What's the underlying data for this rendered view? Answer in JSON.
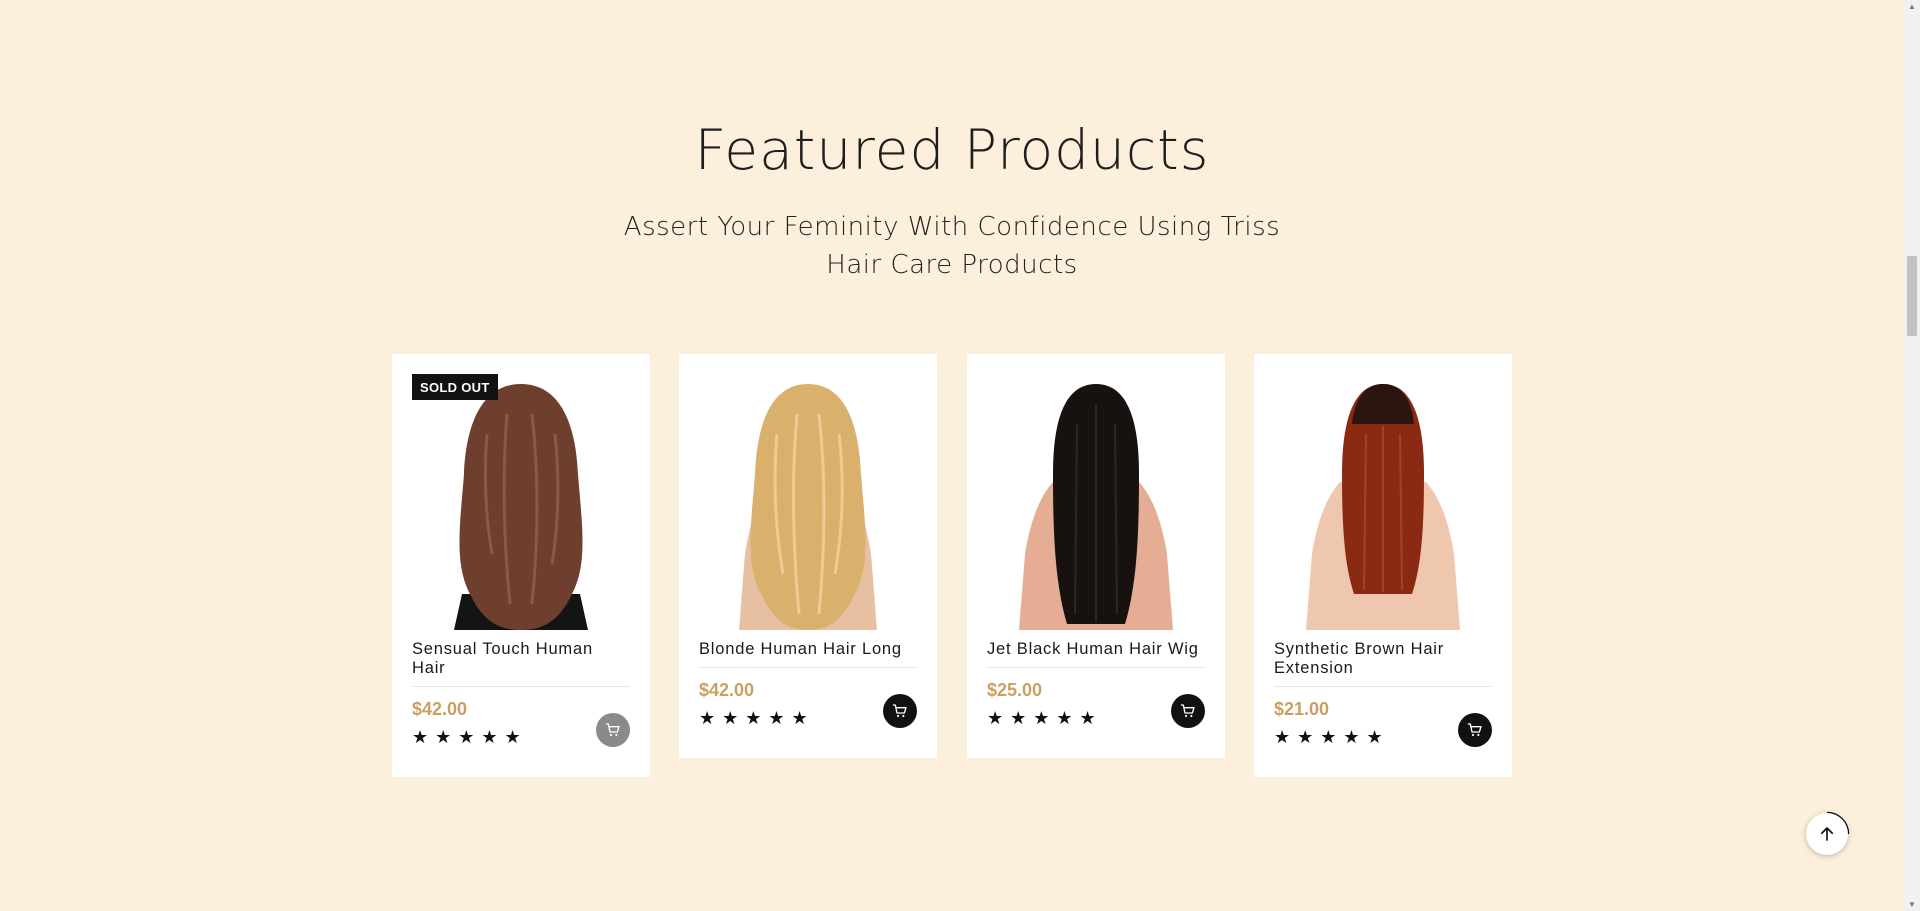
{
  "section": {
    "title": "Featured Products",
    "subtitle": "Assert Your Feminity With Confidence Using Triss Hair Care Products"
  },
  "products": [
    {
      "name": "Sensual Touch Human Hair",
      "price": "$42.00",
      "rating": 5,
      "stars": "★★★★★",
      "badge": "SOLD OUT",
      "hair_color": "#6e3f2e",
      "in_stock": false
    },
    {
      "name": "Blonde Human Hair Long",
      "price": "$42.00",
      "rating": 5,
      "stars": "★★★★★",
      "badge": "",
      "hair_color": "#d9b06c",
      "in_stock": true
    },
    {
      "name": "Jet Black Human Hair Wig",
      "price": "$25.00",
      "rating": 5,
      "stars": "★★★★★",
      "badge": "",
      "hair_color": "#17110f",
      "in_stock": true
    },
    {
      "name": "Synthetic Brown Hair Extension",
      "price": "$21.00",
      "rating": 5,
      "stars": "★★★★★",
      "badge": "",
      "hair_color": "#8a2a12",
      "in_stock": true
    }
  ],
  "icons": {
    "cart": "cart-icon",
    "back_to_top": "arrow-up-icon"
  },
  "colors": {
    "background": "#fcf0dc",
    "price": "#c9a063",
    "badge": "#111111"
  }
}
